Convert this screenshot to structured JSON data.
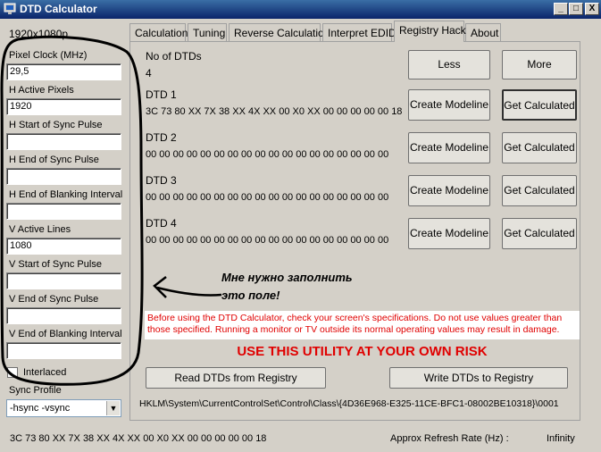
{
  "window": {
    "title": "DTD Calculator",
    "min_label": "_",
    "max_label": "□",
    "close_label": "X"
  },
  "resolution": "1920x1080p",
  "fields": {
    "pixel_clock": {
      "label": "Pixel Clock (MHz)",
      "value": "29,5"
    },
    "h_active": {
      "label": "H Active Pixels",
      "value": "1920"
    },
    "h_sync_start": {
      "label": "H Start of Sync Pulse",
      "value": ""
    },
    "h_sync_end": {
      "label": "H End of Sync Pulse",
      "value": ""
    },
    "h_blank_end": {
      "label": "H End of Blanking Interval",
      "value": ""
    },
    "v_active": {
      "label": "V Active Lines",
      "value": "1080"
    },
    "v_sync_start": {
      "label": "V Start of Sync Pulse",
      "value": ""
    },
    "v_sync_end": {
      "label": "V End of Sync Pulse",
      "value": ""
    },
    "v_blank_end": {
      "label": "V End of Blanking Interval",
      "value": ""
    }
  },
  "interlaced_label": "Interlaced",
  "sync_profile": {
    "label": "Sync Profile",
    "value": "-hsync -vsync"
  },
  "tabs": [
    "Calculation",
    "Tuning",
    "Reverse Calculation",
    "Interpret EDID",
    "Registry Hack",
    "About"
  ],
  "active_tab": "Registry Hack",
  "registry": {
    "no_of_dtds_label": "No of DTDs",
    "no_of_dtds_value": "4",
    "less_label": "Less",
    "more_label": "More",
    "dtds": [
      {
        "title": "DTD 1",
        "hex": "3C 73 80 XX 7X 38 XX 4X XX 00 X0 XX 00 00 00 00 00 18"
      },
      {
        "title": "DTD 2",
        "hex": "00 00 00 00 00 00 00 00 00 00 00 00 00 00 00 00 00 00"
      },
      {
        "title": "DTD 3",
        "hex": "00 00 00 00 00 00 00 00 00 00 00 00 00 00 00 00 00 00"
      },
      {
        "title": "DTD 4",
        "hex": "00 00 00 00 00 00 00 00 00 00 00 00 00 00 00 00 00 00"
      }
    ],
    "create_modeline_label": "Create Modeline",
    "get_calculated_label": "Get Calculated",
    "warning": "Before using the DTD Calculator, check your screen's specifications. Do not use values greater than those specified. Running a monitor or TV outside its normal operating values may result in damage.",
    "risk": "USE THIS UTILITY AT YOUR OWN RISK",
    "read_label": "Read DTDs from Registry",
    "write_label": "Write DTDs to Registry",
    "registry_path": "HKLM\\System\\CurrentControlSet\\Control\\Class\\{4D36E968-E325-11CE-BFC1-08002BE10318}\\0001"
  },
  "annotation": {
    "line1": "Мне нужно заполнить",
    "line2": "это поле!"
  },
  "status": {
    "hex": "3C  73  80  XX  7X  38  XX  4X  XX  00  X0  XX  00  00  00  00  00  18",
    "refresh_label": "Approx Refresh Rate (Hz) :",
    "refresh_value": "Infinity"
  },
  "colors": {
    "warning_red": "#e00000",
    "title_bar": "#0a246a",
    "window_bg": "#d4d0c8"
  }
}
